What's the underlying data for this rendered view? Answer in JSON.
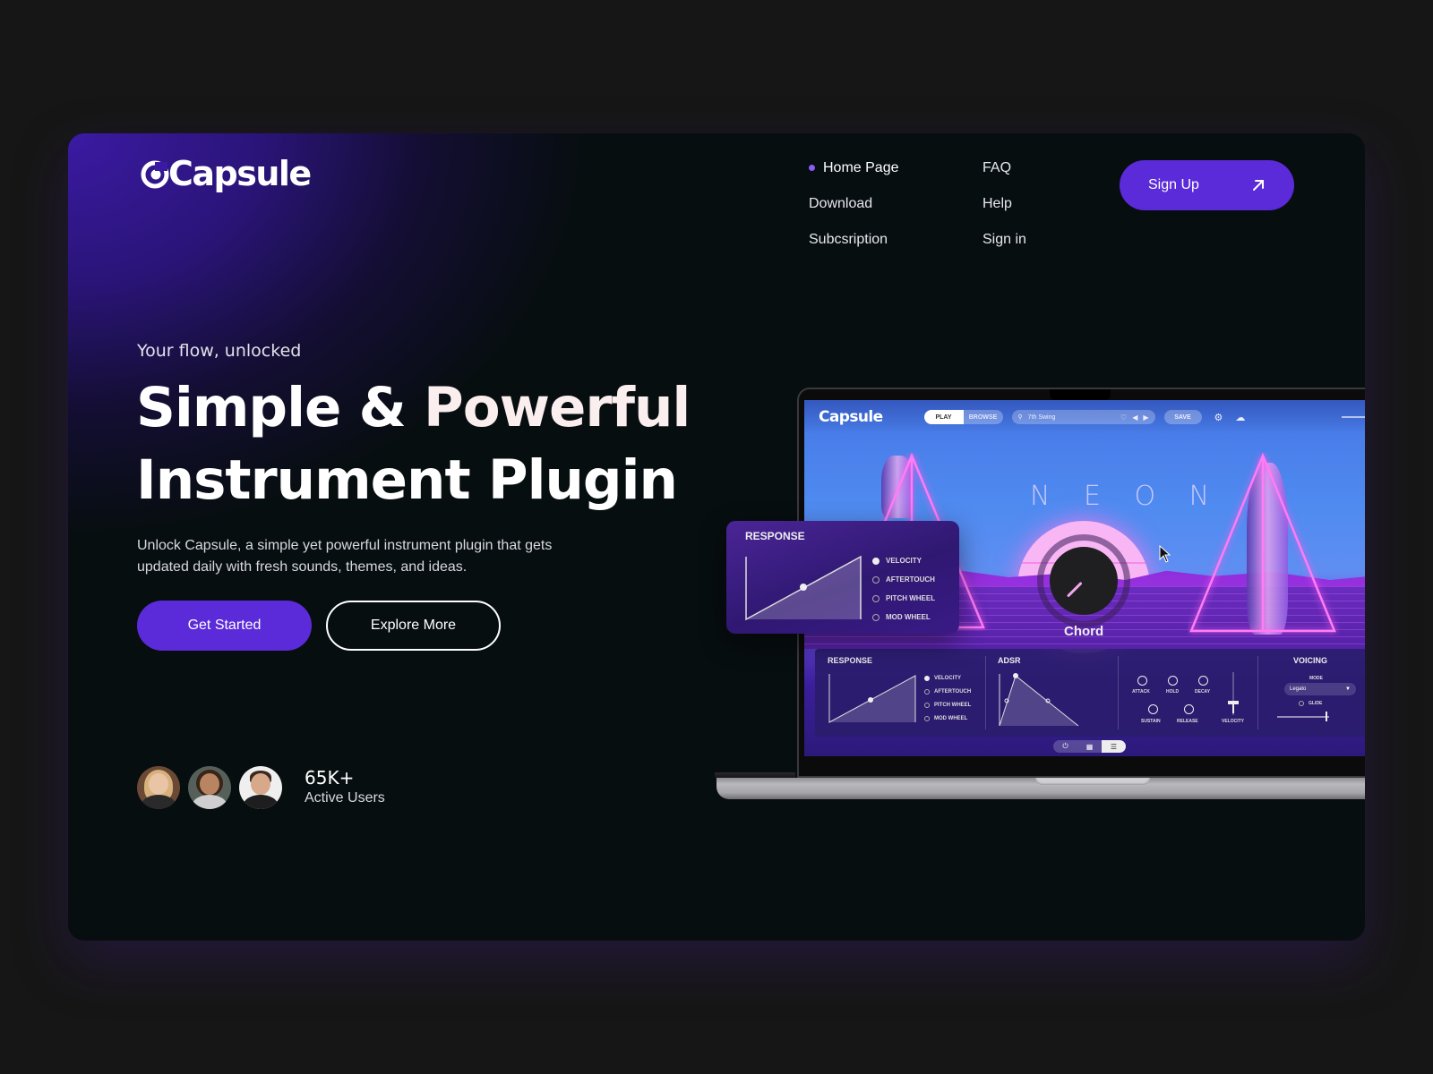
{
  "brand": {
    "name": "Capsule",
    "accent": "#5b2ad9",
    "dot_color": "#8b5cf6"
  },
  "nav": {
    "items": [
      {
        "label": "Home Page",
        "active": true
      },
      {
        "label": "FAQ",
        "active": false
      },
      {
        "label": "Download",
        "active": false
      },
      {
        "label": "Help",
        "active": false
      },
      {
        "label": "Subcsription",
        "active": false
      },
      {
        "label": "Sign in",
        "active": false
      }
    ],
    "signup_label": "Sign Up",
    "signup_icon": "arrow-up-right-icon"
  },
  "hero": {
    "tagline": "Your flow, unlocked",
    "headline_line1_a": "Simple & ",
    "headline_line1_b": "Powerful",
    "headline_line2": "Instrument Plugin",
    "description": "Unlock Capsule, a simple yet powerful instrument plugin that gets updated daily with fresh sounds, themes, and ideas.",
    "primary_cta": "Get Started",
    "secondary_cta": "Explore More"
  },
  "social_proof": {
    "count": "65K+",
    "label": "Active Users",
    "avatars": [
      "avatar-user-1",
      "avatar-user-2",
      "avatar-user-3"
    ]
  },
  "plugin_ui": {
    "logo": "Capsule",
    "tabs": [
      {
        "label": "PLAY",
        "active": true
      },
      {
        "label": "BROWSE",
        "active": false
      }
    ],
    "preset_search_value": "7th Swing",
    "save_label": "SAVE",
    "theme_title": "N E O N",
    "main_knob_label": "Chord",
    "response": {
      "title": "RESPONSE",
      "options": [
        {
          "label": "VELOCITY",
          "selected": true
        },
        {
          "label": "AFTERTOUCH",
          "selected": false
        },
        {
          "label": "PITCH WHEEL",
          "selected": false
        },
        {
          "label": "MOD WHEEL",
          "selected": false
        }
      ]
    },
    "adsr": {
      "title": "ADSR",
      "knobs": [
        "ATTACK",
        "HOLD",
        "DECAY",
        "SUSTAIN",
        "RELEASE"
      ],
      "slider_label": "VELOCITY"
    },
    "voicing": {
      "title": "VOICING",
      "mode_label": "MODE",
      "mode_value": "Legato",
      "glide_label": "GLIDE"
    },
    "bottom_tabs": [
      "power-icon",
      "keyboard-icon",
      "sliders-icon"
    ]
  }
}
